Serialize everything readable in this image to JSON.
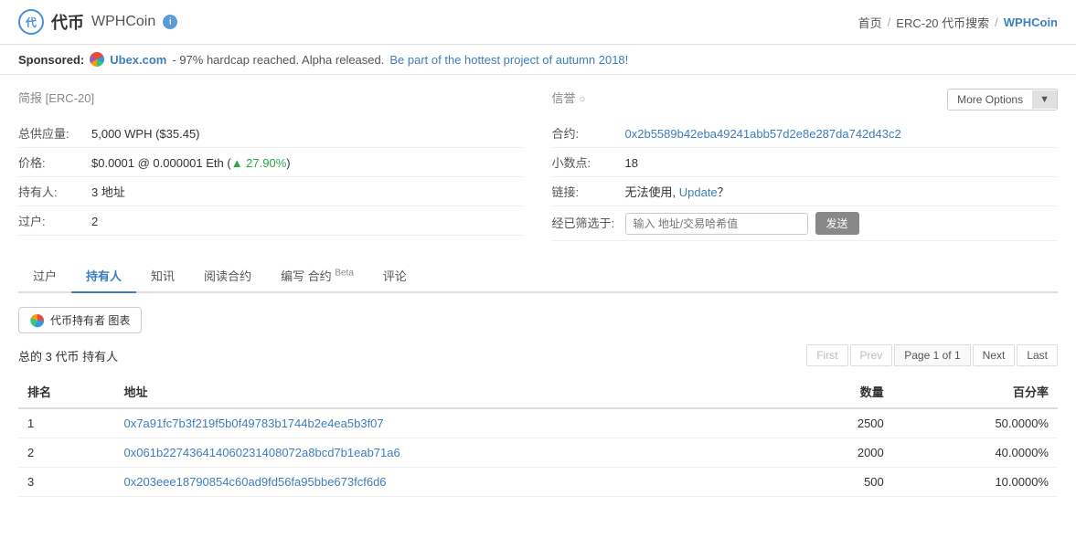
{
  "header": {
    "logo_symbol": "代币",
    "app_name": "WPHCoin",
    "info_tooltip": "i",
    "nav": {
      "home": "首页",
      "separator1": "/",
      "erc20": "ERC-20 代币搜索",
      "separator2": "/",
      "current": "WPHCoin"
    }
  },
  "sponsored": {
    "label": "Sponsored:",
    "site_name": "Ubex.com",
    "description": "- 97% hardcap reached. Alpha released.",
    "cta": "Be part of the hottest project of autumn 2018!"
  },
  "left_panel": {
    "section_title": "简报",
    "section_subtitle": "[ERC-20]",
    "rows": [
      {
        "label": "总供应量:",
        "value": "5,000 WPH ($35.45)"
      },
      {
        "label": "价格:",
        "value": "$0.0001 @ 0.000001 Eth (▲ 27.90%)"
      },
      {
        "label": "持有人:",
        "value": "3 地址"
      },
      {
        "label": "过户:",
        "value": "2"
      }
    ]
  },
  "right_panel": {
    "section_title": "信誉",
    "more_options_label": "More Options",
    "more_options_arrow": "▼",
    "rows": [
      {
        "label": "合约:",
        "value": "0x2b5589b42eba49241abb57d2e8e287da742d43c2",
        "is_link": true
      },
      {
        "label": "小数点:",
        "value": "18",
        "is_link": false
      },
      {
        "label": "链接:",
        "value": "无法使用, Update？",
        "has_update": true
      },
      {
        "label": "经已筛选于:",
        "value": "",
        "has_filter": true
      }
    ],
    "filter_placeholder": "输入 地址/交易哈希值",
    "filter_button": "发送"
  },
  "tabs": [
    {
      "id": "transfers",
      "label": "过户",
      "active": false
    },
    {
      "id": "holders",
      "label": "持有人",
      "active": true
    },
    {
      "id": "info",
      "label": "知讯",
      "active": false
    },
    {
      "id": "read-contract",
      "label": "阅读合约",
      "active": false
    },
    {
      "id": "write-contract",
      "label": "编写 合约",
      "active": false,
      "badge": "Beta"
    },
    {
      "id": "comments",
      "label": "评论",
      "active": false
    }
  ],
  "holders_section": {
    "chart_button_label": "代币持有者 图表",
    "total_label": "总的 3 代币 持有人",
    "pagination": {
      "first": "First",
      "prev": "Prev",
      "page_info": "Page 1 of 1",
      "next": "Next",
      "last": "Last"
    },
    "table": {
      "columns": [
        "排名",
        "地址",
        "数量",
        "百分率"
      ],
      "rows": [
        {
          "rank": "1",
          "address": "0x7a91fc7b3f219f5b0f49783b1744b2e4ea5b3f07",
          "amount": "2500",
          "percent": "50.0000%"
        },
        {
          "rank": "2",
          "address": "0x061b227436414060231408072a8bcd7b1eab71a6",
          "amount": "2000",
          "percent": "40.0000%"
        },
        {
          "rank": "3",
          "address": "0x203eee18790854c60ad9fd56fa95bbe673fcf6d6",
          "amount": "500",
          "percent": "10.0000%"
        }
      ]
    }
  }
}
